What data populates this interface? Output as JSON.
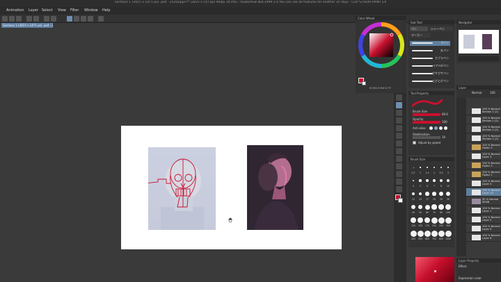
{
  "window": {
    "title": "Sections 1 (2815 x 1471 px) .psd - 252Dupps f* (2815 x 1471px 96dpi 30.0%) - RGBa/RGB 8DC1999 2.0  You can use all features for another 35 days - CLIP STUDIO PAINT EX"
  },
  "menu": [
    "Animation",
    "Layer",
    "Select",
    "View",
    "Filter",
    "Window",
    "Help"
  ],
  "document_tab": "Sections 1 (2815 x 1471 px) .psd - 252Dupps f* ×",
  "panels": {
    "color_wheel": {
      "title": "Color Wheel",
      "readout": "H 351 S 94 V 77",
      "accent": "#c8102e"
    },
    "subtool": {
      "title": "Sub Tool",
      "tabs": [
        "ペン",
        "シャーペン",
        "マーカー"
      ],
      "brushes": [
        "Gペン",
        "丸ペン",
        "カブラペン",
        "リアルGペン",
        "ガサガサペン",
        "とげとげペン"
      ]
    },
    "navigator": {
      "title": "Navigator"
    },
    "layer": {
      "title": "Layer",
      "blend": "Normal",
      "opacity": "100",
      "rows": [
        {
          "pct": "100 %",
          "mode": "Normal",
          "name": "Section 1 (2)",
          "selected": false
        },
        {
          "pct": "100 %",
          "mode": "Normal",
          "name": "Section 1 (2)",
          "selected": false
        },
        {
          "pct": "100 %",
          "mode": "Normal",
          "name": "Section 1 (2)",
          "selected": false
        },
        {
          "pct": "100 %",
          "mode": "Normal",
          "name": "Section 1 (2)",
          "selected": false
        },
        {
          "pct": "100 %",
          "mode": "Normal",
          "name": "Folder 3",
          "selected": false
        },
        {
          "pct": "100 %",
          "mode": "Normal",
          "name": "Layer 3",
          "selected": false
        },
        {
          "pct": "100 %",
          "mode": "Normal",
          "name": "Folder 2",
          "selected": false
        },
        {
          "pct": "100 %",
          "mode": "Normal",
          "name": "Folder 1",
          "selected": false
        },
        {
          "pct": "100 %",
          "mode": "Normal",
          "name": "Layer 3",
          "selected": false
        },
        {
          "pct": "100 %",
          "mode": "Normal",
          "name": "Layer 10",
          "selected": true
        },
        {
          "pct": "30 %",
          "mode": "Normal",
          "name": "IS008",
          "selected": false
        },
        {
          "pct": "100 %",
          "mode": "Normal",
          "name": "Layer 1",
          "selected": false
        },
        {
          "pct": "100 %",
          "mode": "Normal",
          "name": "Layer 5",
          "selected": false
        },
        {
          "pct": "100 %",
          "mode": "Normal",
          "name": "Layer 4",
          "selected": false
        },
        {
          "pct": "100 %",
          "mode": "Normal",
          "name": "Layer 6",
          "selected": false
        }
      ]
    },
    "tool_property": {
      "title": "Tool Property",
      "brush_size_label": "Brush Size",
      "brush_size_value": "69.0",
      "opacity_label": "Opacity",
      "opacity_value": "100",
      "antialias_label": "Anti-alias",
      "stabilization_label": "Stabilization",
      "stabilization_value": "10",
      "adjust_label": "Adjust by speed"
    },
    "brush_size": {
      "title": "Brush Size",
      "values": [
        "0.7",
        "1",
        "1.5",
        "2",
        "2.5",
        "3",
        "4",
        "5",
        "6",
        "7",
        "8",
        "10",
        "12",
        "15",
        "17",
        "20",
        "25",
        "30",
        "40",
        "50",
        "60",
        "70",
        "80",
        "100",
        "120",
        "150",
        "170",
        "200",
        "250",
        "300",
        "400",
        "500",
        "600",
        "700",
        "800",
        "1000"
      ]
    },
    "layer_property": {
      "title": "Layer Property",
      "effect_label": "Effect",
      "expression_label": "Expression color"
    }
  },
  "icons": [
    "move-icon",
    "zoom-icon",
    "pen-icon",
    "eraser-icon",
    "fill-icon",
    "text-icon",
    "eyedropper-icon",
    "hand-cursor-icon"
  ]
}
